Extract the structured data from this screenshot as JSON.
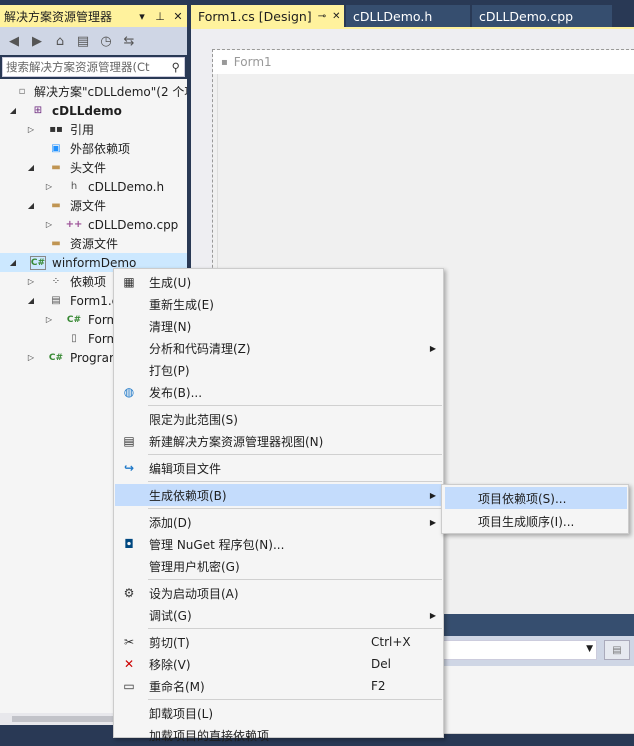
{
  "solution_explorer": {
    "title": "解决方案资源管理器",
    "title_buttons": [
      "▾",
      "⊥",
      "✕"
    ],
    "search_placeholder": "搜索解决方案资源管理器(Ct",
    "tree": [
      {
        "label": "解决方案\"cDLLdemo\"(2 个项",
        "icon": "solution-icon"
      },
      {
        "label": "cDLLdemo",
        "icon": "cpp-project-icon"
      },
      {
        "label": "引用",
        "icon": "references-icon"
      },
      {
        "label": "外部依赖项",
        "icon": "external-deps-icon"
      },
      {
        "label": "头文件",
        "icon": "folder-icon"
      },
      {
        "label": "cDLLDemo.h",
        "icon": "header-file-icon"
      },
      {
        "label": "源文件",
        "icon": "folder-icon"
      },
      {
        "label": "cDLLDemo.cpp",
        "icon": "cpp-file-icon"
      },
      {
        "label": "资源文件",
        "icon": "folder-icon"
      },
      {
        "label": "winformDemo",
        "icon": "csharp-project-icon"
      },
      {
        "label": "依赖项",
        "icon": "dependencies-icon"
      },
      {
        "label": "Form1.c",
        "icon": "form-icon"
      },
      {
        "label": "Form",
        "icon": "csharp-file-icon"
      },
      {
        "label": "Form",
        "icon": "file-icon"
      },
      {
        "label": "Prograr",
        "icon": "csharp-file-icon"
      }
    ]
  },
  "editor": {
    "tabs": [
      {
        "label": "Form1.cs [Design]",
        "pin": "⊸",
        "close": "✕"
      },
      {
        "label": "cDLLDemo.h"
      },
      {
        "label": "cDLLDemo.cpp"
      }
    ],
    "form_title": "Form1"
  },
  "context_menu": {
    "items": [
      {
        "label": "生成(U)",
        "icon": "build-icon"
      },
      {
        "label": "重新生成(E)"
      },
      {
        "label": "清理(N)"
      },
      {
        "label": "分析和代码清理(Z)",
        "submenu": true
      },
      {
        "label": "打包(P)"
      },
      {
        "label": "发布(B)...",
        "icon": "publish-icon"
      },
      {
        "label": "限定为此范围(S)"
      },
      {
        "label": "新建解决方案资源管理器视图(N)",
        "icon": "new-view-icon"
      },
      {
        "label": "编辑项目文件",
        "icon": "edit-project-icon"
      },
      {
        "label": "生成依赖项(B)",
        "submenu": true
      },
      {
        "label": "添加(D)",
        "submenu": true
      },
      {
        "label": "管理 NuGet 程序包(N)...",
        "icon": "nuget-icon"
      },
      {
        "label": "管理用户机密(G)"
      },
      {
        "label": "设为启动项目(A)",
        "icon": "gear-icon"
      },
      {
        "label": "调试(G)",
        "submenu": true
      },
      {
        "label": "剪切(T)",
        "shortcut": "Ctrl+X",
        "icon": "cut-icon"
      },
      {
        "label": "移除(V)",
        "shortcut": "Del",
        "icon": "remove-icon"
      },
      {
        "label": "重命名(M)",
        "shortcut": "F2",
        "icon": "rename-icon"
      },
      {
        "label": "卸载项目(L)"
      },
      {
        "label": "加载项目的直接依赖项"
      }
    ]
  },
  "submenu": {
    "items": [
      {
        "label": "项目依赖项(S)..."
      },
      {
        "label": "项目生成顺序(I)..."
      }
    ]
  },
  "colors": {
    "active_title": "#fff29d",
    "highlight": "#c4dcfc",
    "selection": "#cce8ff",
    "frame": "#293955"
  }
}
